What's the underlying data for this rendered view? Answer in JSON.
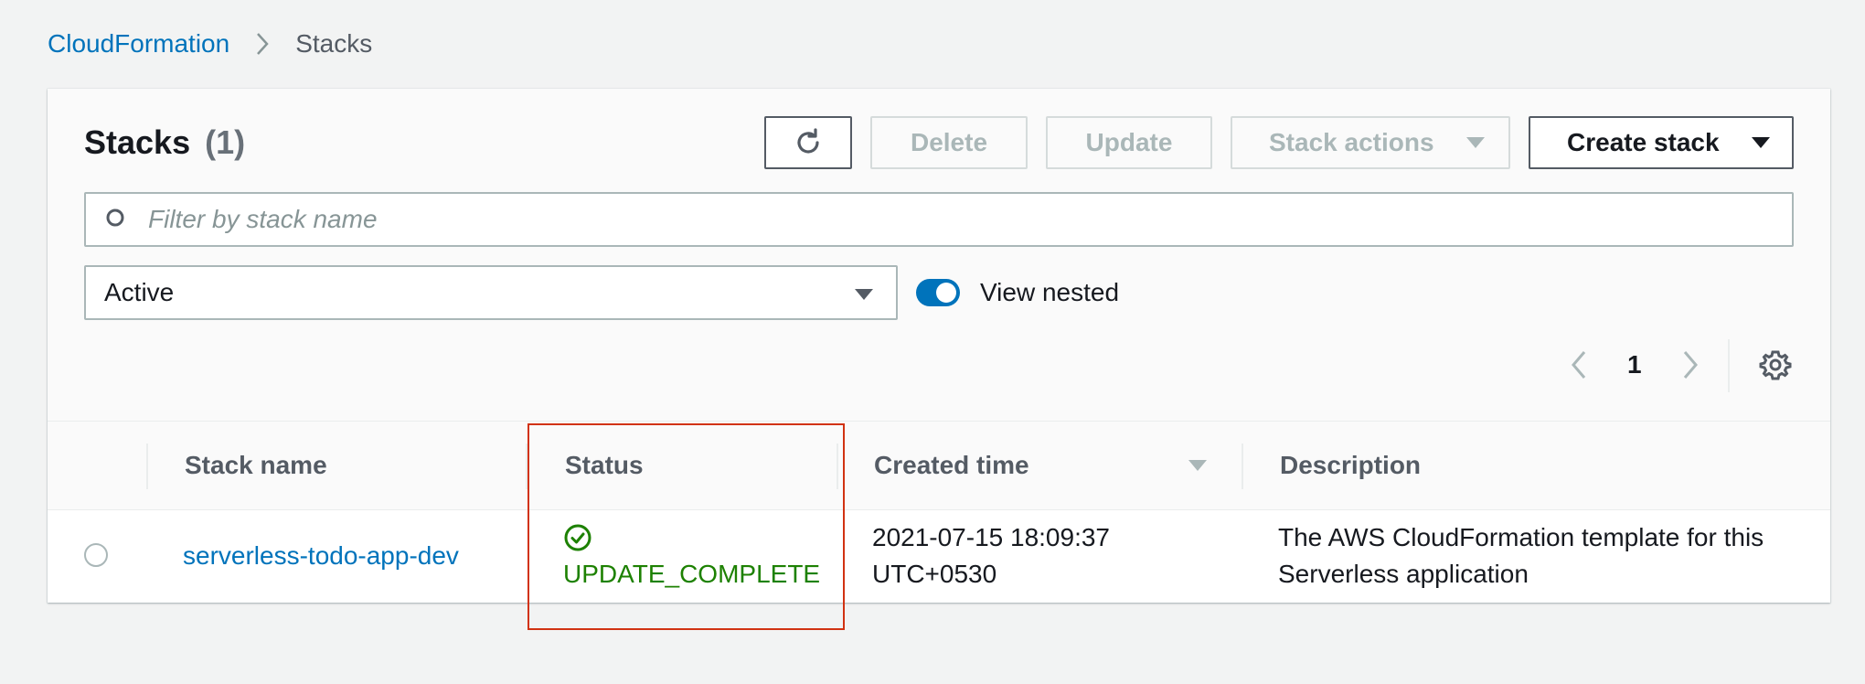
{
  "breadcrumb": {
    "root": "CloudFormation",
    "current": "Stacks"
  },
  "header": {
    "title": "Stacks",
    "count": "(1)"
  },
  "toolbar": {
    "delete_label": "Delete",
    "update_label": "Update",
    "stack_actions_label": "Stack actions",
    "create_stack_label": "Create stack"
  },
  "search": {
    "placeholder": "Filter by stack name"
  },
  "filter": {
    "selected": "Active"
  },
  "toggle": {
    "label": "View nested",
    "on": true
  },
  "pagination": {
    "current": "1"
  },
  "table": {
    "columns": [
      "Stack name",
      "Status",
      "Created time",
      "Description"
    ],
    "rows": [
      {
        "stack_name": "serverless-todo-app-dev",
        "status": "UPDATE_COMPLETE",
        "created_line1": "2021-07-15 18:09:37",
        "created_line2": "UTC+0530",
        "description_line1": "The AWS CloudFormation template for this",
        "description_line2": "Serverless application"
      }
    ]
  },
  "colors": {
    "link": "#0073bb",
    "success": "#1d8102",
    "highlight": "#d13212",
    "toggle_on": "#0073bb"
  }
}
